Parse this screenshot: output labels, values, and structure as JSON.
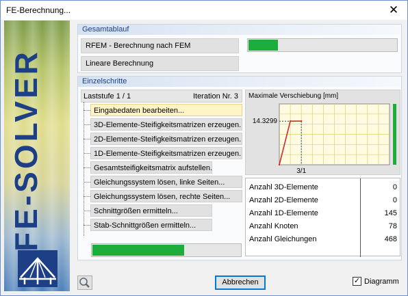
{
  "window": {
    "title": "FE-Berechnung...",
    "close_glyph": "✕"
  },
  "sidebar": {
    "brand_text": "FE-SOLVER"
  },
  "overall": {
    "header": "Gesamtablauf",
    "task": "RFEM - Berechnung nach FEM",
    "method": "Lineare Berechnung",
    "progress": 0.2
  },
  "steps_group": {
    "header": "Einzelschritte",
    "load_step": "Laststufe 1 / 1",
    "iteration": "Iteration Nr. 3",
    "steps": [
      "Eingabedaten bearbeiten...",
      "3D-Elemente-Steifigkeitsmatrizen erzeugen...",
      "2D-Elemente-Steifigkeitsmatrizen erzeugen...",
      "1D-Elemente-Steifigkeitsmatrizen erzeugen...",
      "Gesamtsteifigkeitsmatrix aufstellen...",
      "Gleichungssystem lösen, linke Seiten...",
      "Gleichungssystem lösen, rechte Seiten...",
      "Schnittgrößen ermitteln...",
      "Stab-Schnittgrößen ermitteln..."
    ],
    "active_step": 0,
    "progress": 0.62
  },
  "chart_data": {
    "type": "line",
    "title": "Maximale Verschiebung [mm]",
    "x_tick": "3/1",
    "y_tick": "14.3299",
    "points": [
      [
        0,
        0
      ],
      [
        0.5,
        14.3299
      ],
      [
        1,
        14.3299
      ]
    ],
    "xlim": [
      0,
      5
    ],
    "ylim": [
      0,
      20
    ],
    "side_bar_level": 1.0,
    "colors": {
      "line": "#d42a2a",
      "bar": "#1cad3a",
      "grid": "#d8d070",
      "background": "#fffbe0"
    }
  },
  "stats": {
    "rows": [
      {
        "label": "Anzahl 3D-Elemente",
        "value": "0"
      },
      {
        "label": "Anzahl 2D-Elemente",
        "value": "0"
      },
      {
        "label": "Anzahl 1D-Elemente",
        "value": "145"
      },
      {
        "label": "Anzahl Knoten",
        "value": "78"
      },
      {
        "label": "Anzahl Gleichungen",
        "value": "468"
      }
    ]
  },
  "footer": {
    "cancel_label": "Abbrechen",
    "diagram_label": "Diagramm",
    "diagram_checked": true,
    "check_glyph": "✓",
    "zoom_icon": "magnifier-icon"
  }
}
